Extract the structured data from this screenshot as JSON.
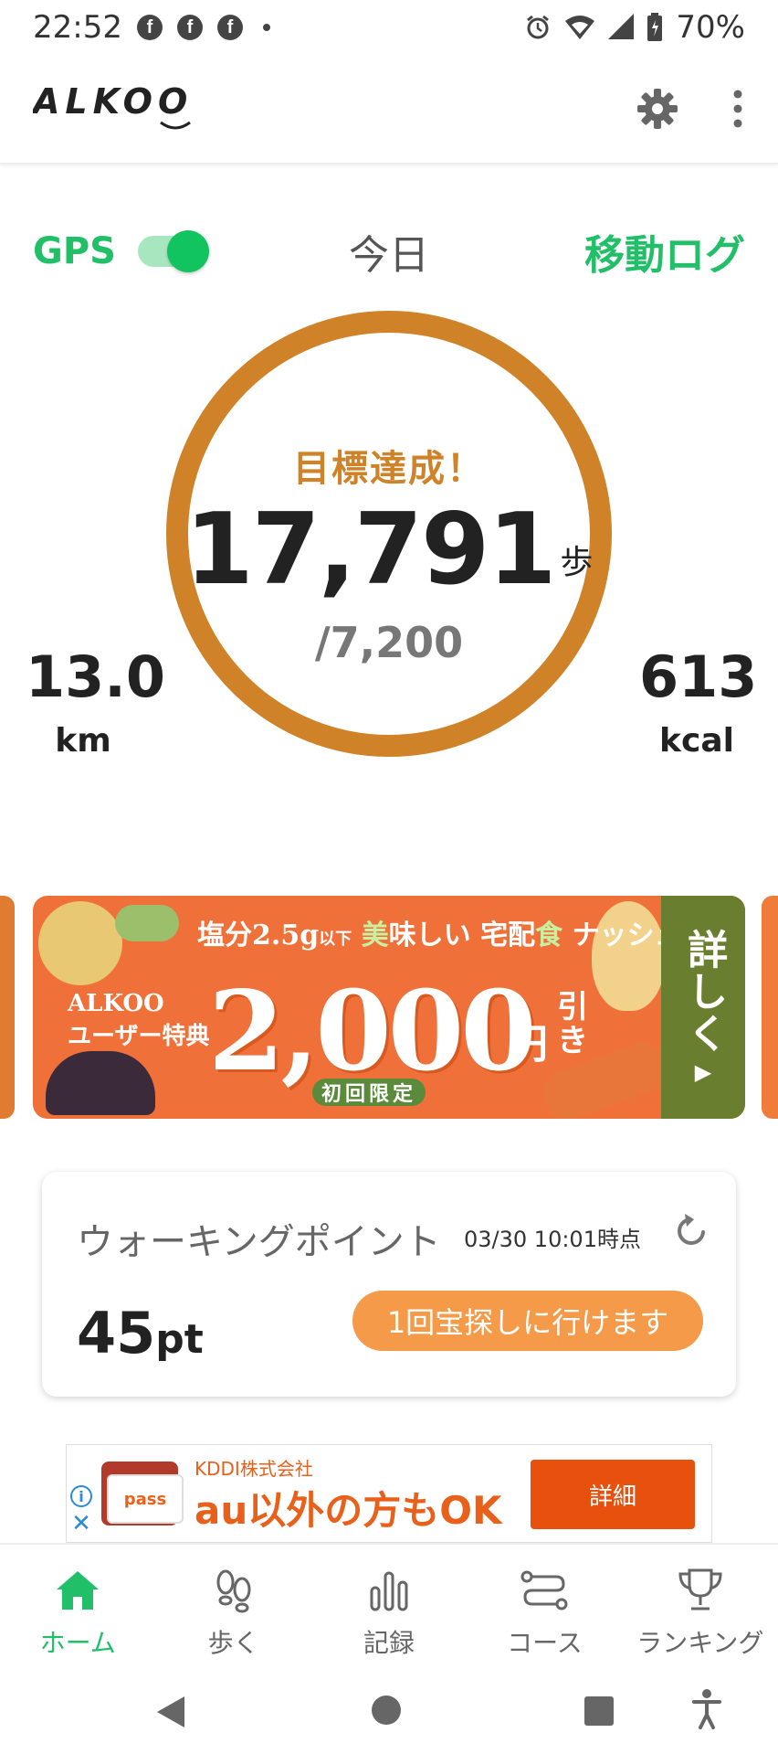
{
  "status_bar": {
    "time": "22:52",
    "battery": "70%",
    "icons": [
      "facebook-icon",
      "facebook-icon",
      "facebook-icon",
      "notification-dot-icon",
      "alarm-icon",
      "wifi-icon",
      "signal-icon",
      "battery-icon"
    ]
  },
  "app_bar": {
    "logo": "ALKOO",
    "actions": [
      "gear-icon",
      "more-vert-icon"
    ]
  },
  "top_row": {
    "gps_label": "GPS",
    "gps_enabled": true,
    "today": "今日",
    "log_link": "移動ログ"
  },
  "progress": {
    "status": "目標達成！",
    "steps": "17,791",
    "steps_unit": "歩",
    "goal": "/7,200",
    "distance": "13.0",
    "distance_unit": "km",
    "calories": "613",
    "calories_unit": "kcal",
    "ring_color": "#d08228"
  },
  "banner": {
    "headline_a": "塩分2.5g",
    "headline_small": "以下",
    "headline_green_1": "美",
    "headline_b": "味しい",
    "headline_c": "宅配",
    "headline_green_2": "食",
    "headline_brand": "ナッシュ",
    "left_line_1": "ALKOO",
    "left_line_2": "ユーザー特典",
    "amount": "2,000",
    "amount_unit": "円",
    "discount": "引き",
    "limit": "初回限定",
    "detail": "詳しく"
  },
  "points_card": {
    "title": "ウォーキングポイント",
    "updated": "03/30 10:01時点",
    "value": "45",
    "unit": "pt",
    "treasure_button": "1回宝探しに行けます"
  },
  "ad": {
    "company": "KDDI株式会社",
    "headline": "au以外の方もOK",
    "card_label": "pass",
    "button": "詳細"
  },
  "bottom_nav": {
    "items": [
      {
        "label": "ホーム",
        "icon": "home-icon",
        "active": true
      },
      {
        "label": "歩く",
        "icon": "footprints-icon",
        "active": false
      },
      {
        "label": "記録",
        "icon": "bar-chart-icon",
        "active": false
      },
      {
        "label": "コース",
        "icon": "route-icon",
        "active": false
      },
      {
        "label": "ランキング",
        "icon": "trophy-icon",
        "active": false
      }
    ]
  },
  "colors": {
    "accent_green": "#21c068",
    "ring_orange": "#d08228",
    "button_orange": "#f49a48",
    "banner_orange": "#f0703a"
  }
}
